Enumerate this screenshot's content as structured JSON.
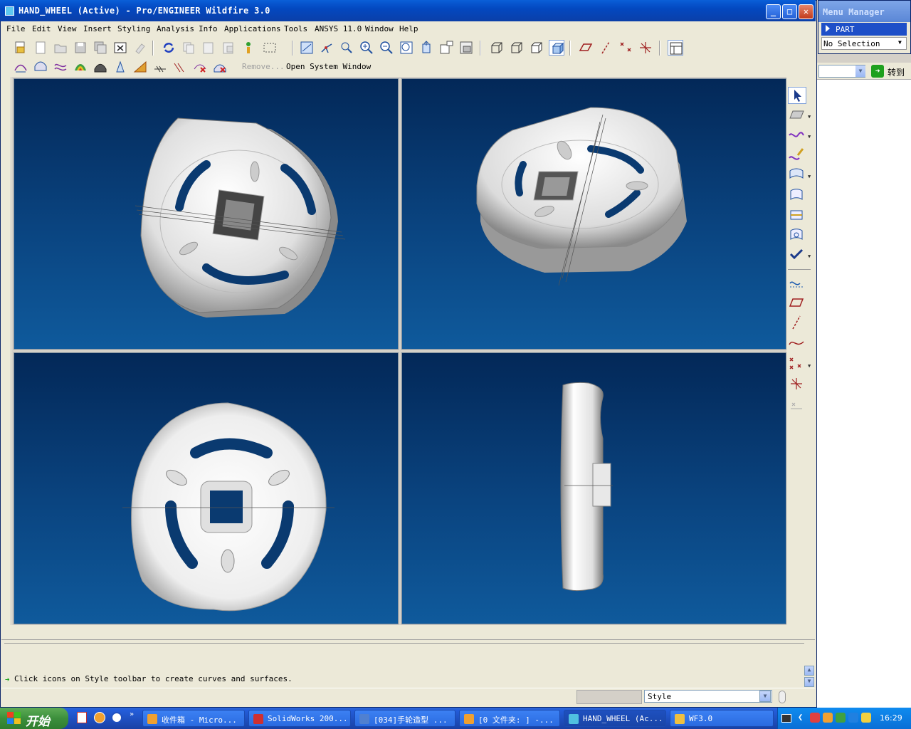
{
  "window": {
    "title": "HAND_WHEEL (Active) - Pro/ENGINEER Wildfire 3.0",
    "minimize": "_",
    "maximize": "□",
    "close": "✕"
  },
  "menu": [
    "File",
    "Edit",
    "View",
    "Insert",
    "Styling",
    "Analysis",
    "Info",
    "Applications",
    "Tools",
    "ANSYS 11.0",
    "Window",
    "Help"
  ],
  "toolbar2": {
    "remove_label": "Remove...",
    "open_system_window": "Open System Window"
  },
  "message": {
    "text": "Click icons on Style toolbar to create curves and surfaces."
  },
  "status": {
    "style_select": "Style"
  },
  "menu_manager": {
    "title": "Menu Manager",
    "part": "PART",
    "selection": "No Selection"
  },
  "browser": {
    "goto_label": "转到"
  },
  "taskbar": {
    "start": "开始",
    "tasks": [
      {
        "label": "收件箱 - Micro...",
        "color": "#f0a030"
      },
      {
        "label": "SolidWorks 200...",
        "color": "#d03030"
      },
      {
        "label": "[034]手轮造型 ...",
        "color": "#5080d0"
      },
      {
        "label": "[0 文件夹: ] -...",
        "color": "#f0a030"
      },
      {
        "label": "HAND_WHEEL (Ac...",
        "color": "#50c0e0"
      },
      {
        "label": "WF3.0",
        "color": "#f0c040"
      }
    ],
    "clock": "16:29"
  },
  "colors": {
    "titlebar": "#0a5fd8",
    "viewport_top": "#032858",
    "viewport_bottom": "#0f5a9c",
    "model": "#e8e8e8"
  }
}
